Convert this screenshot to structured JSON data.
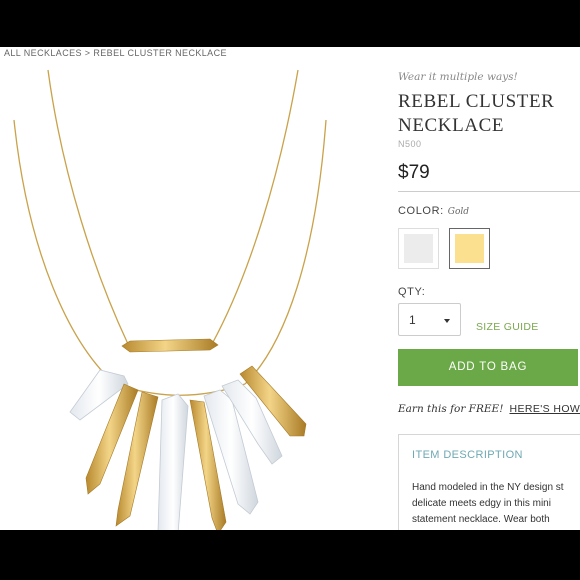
{
  "breadcrumb": {
    "parent": "ALL NECKLACES",
    "separator": " > ",
    "current": "REBEL CLUSTER NECKLACE"
  },
  "product": {
    "tagline": "Wear it multiple ways!",
    "title_line1": "REBEL CLUSTER",
    "title_line2": "NECKLACE",
    "sku": "N500",
    "price": "$79"
  },
  "color": {
    "label": "COLOR:",
    "selected": "Gold",
    "swatches": [
      {
        "name": "Silver",
        "color": "#ececec"
      },
      {
        "name": "Gold",
        "color": "#fbe08f"
      }
    ]
  },
  "quantity": {
    "label": "QTY:",
    "value": "1"
  },
  "size_guide": "SIZE GUIDE",
  "add_to_bag": "ADD TO BAG",
  "earn": {
    "text": "Earn this for FREE!",
    "link": "HERE'S HOW"
  },
  "description": {
    "heading": "ITEM DESCRIPTION",
    "line1": "Hand modeled in the NY design st",
    "line2": "delicate meets edgy in this mini",
    "line3": "statement necklace. Wear both"
  },
  "colors": {
    "accent_green": "#6ba847",
    "heading_teal": "#6fa8b3",
    "gold": "#d9b25a"
  }
}
